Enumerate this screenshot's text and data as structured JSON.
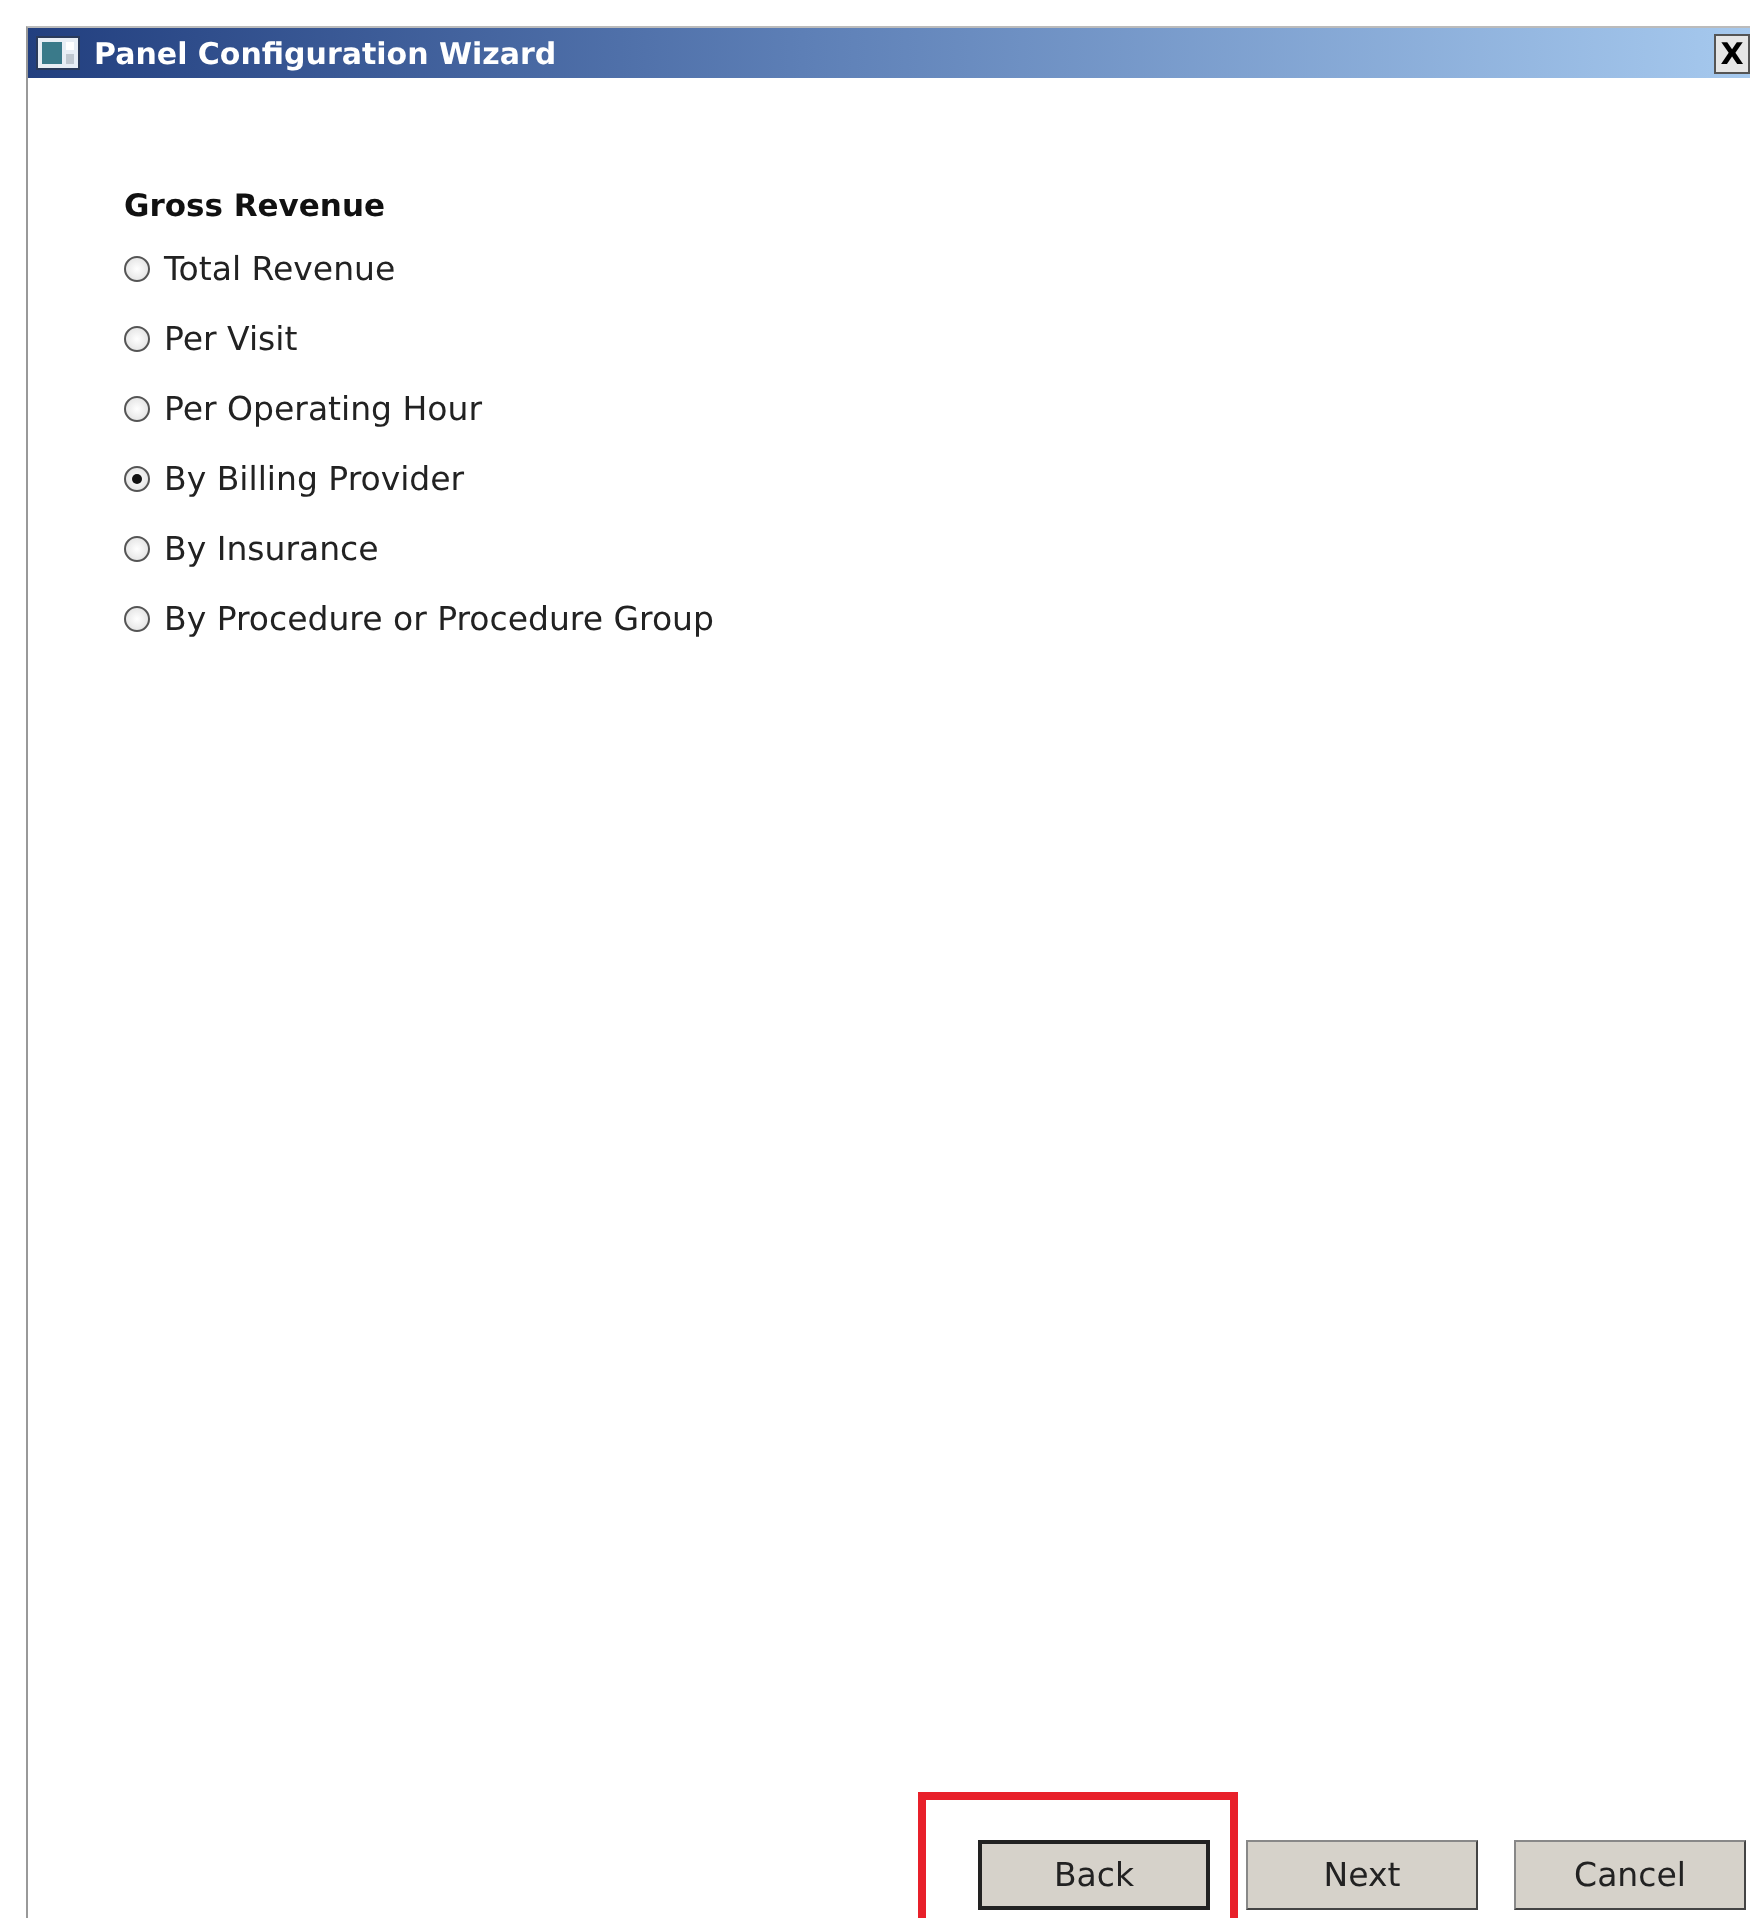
{
  "window": {
    "title": "Panel Configuration Wizard",
    "close": "X"
  },
  "group": {
    "heading": "Gross Revenue",
    "options": [
      {
        "label": "Total Revenue",
        "selected": false
      },
      {
        "label": "Per Visit",
        "selected": false
      },
      {
        "label": "Per Operating Hour",
        "selected": false
      },
      {
        "label": "By Billing Provider",
        "selected": true
      },
      {
        "label": "By Insurance",
        "selected": false
      },
      {
        "label": "By Procedure or Procedure Group",
        "selected": false
      }
    ]
  },
  "buttons": [
    {
      "label": "Back",
      "default": true,
      "highlighted": true
    },
    {
      "label": "Next",
      "default": false,
      "highlighted": false
    },
    {
      "label": "Cancel",
      "default": false,
      "highlighted": false
    }
  ]
}
